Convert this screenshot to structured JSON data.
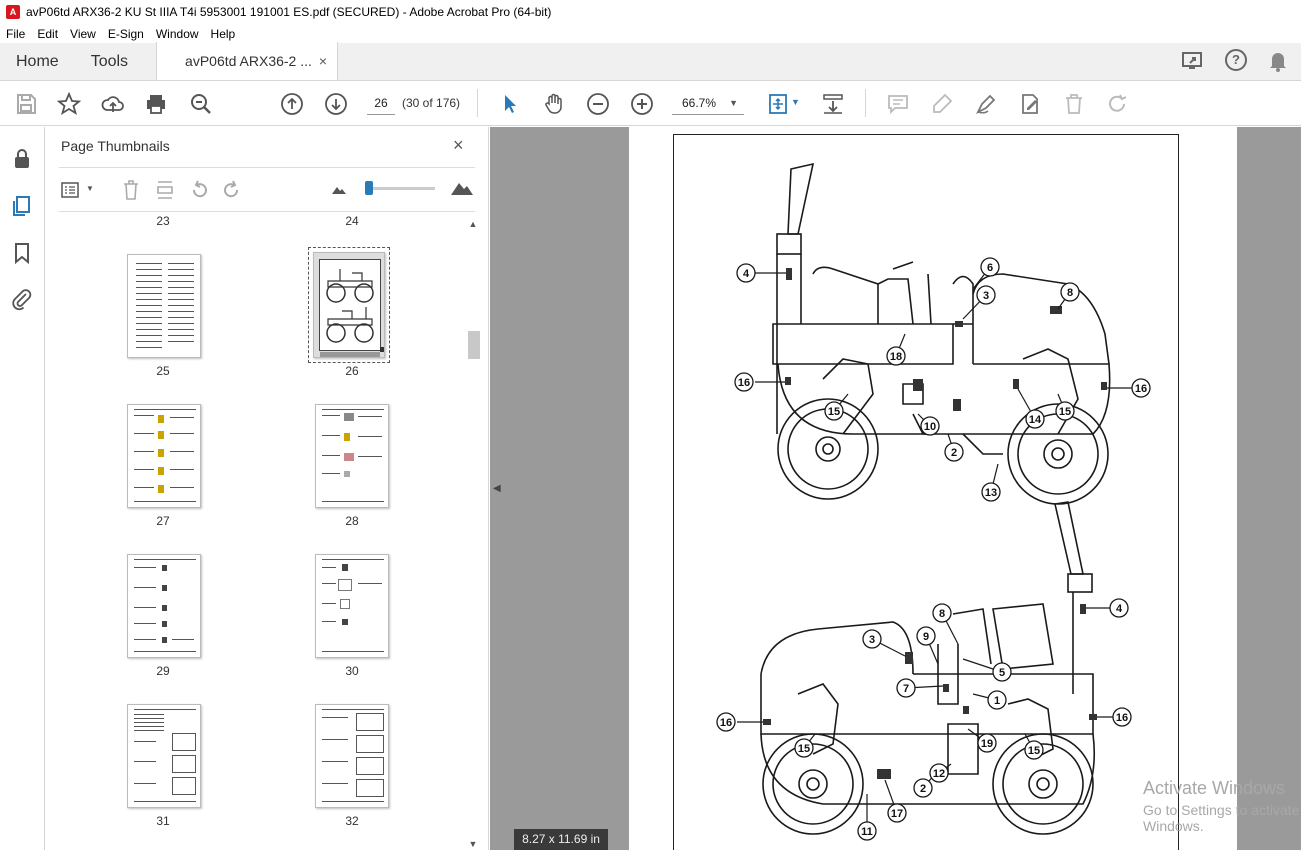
{
  "window": {
    "title": "avP06td ARX36-2 KU St IIIA T4i 5953001 191001 ES.pdf (SECURED) - Adobe Acrobat Pro (64-bit)"
  },
  "menu": [
    "File",
    "Edit",
    "View",
    "E-Sign",
    "Window",
    "Help"
  ],
  "tabs": {
    "home": "Home",
    "tools": "Tools",
    "document": "avP06td ARX36-2 ...",
    "close": "×"
  },
  "toolbar": {
    "page_number": "26",
    "page_count": "(30 of 176)",
    "zoom": "66.7%"
  },
  "thumbnails_panel": {
    "title": "Page Thumbnails",
    "close": "×",
    "top_labels": [
      "23",
      "24"
    ],
    "pages": [
      {
        "label": "25",
        "selected": false
      },
      {
        "label": "26",
        "selected": true
      },
      {
        "label": "27",
        "selected": false
      },
      {
        "label": "28",
        "selected": false
      },
      {
        "label": "29",
        "selected": false
      },
      {
        "label": "30",
        "selected": false
      },
      {
        "label": "31",
        "selected": false
      },
      {
        "label": "32",
        "selected": false
      }
    ]
  },
  "document": {
    "page_size": "8.27 x 11.69 in",
    "callouts_top": [
      "4",
      "6",
      "3",
      "8",
      "16",
      "18",
      "15",
      "16",
      "14",
      "15",
      "10",
      "2",
      "13"
    ],
    "callouts_bottom": [
      "4",
      "8",
      "3",
      "9",
      "5",
      "7",
      "1",
      "16",
      "16",
      "15",
      "19",
      "15",
      "12",
      "2",
      "17",
      "11"
    ]
  },
  "watermark": {
    "line1": "Activate Windows",
    "line2": "Go to Settings to activate Windows."
  },
  "colors": {
    "accent": "#2a7ab8",
    "doc_background": "#9a9a9a",
    "pdf_icon": "#d7161e"
  }
}
